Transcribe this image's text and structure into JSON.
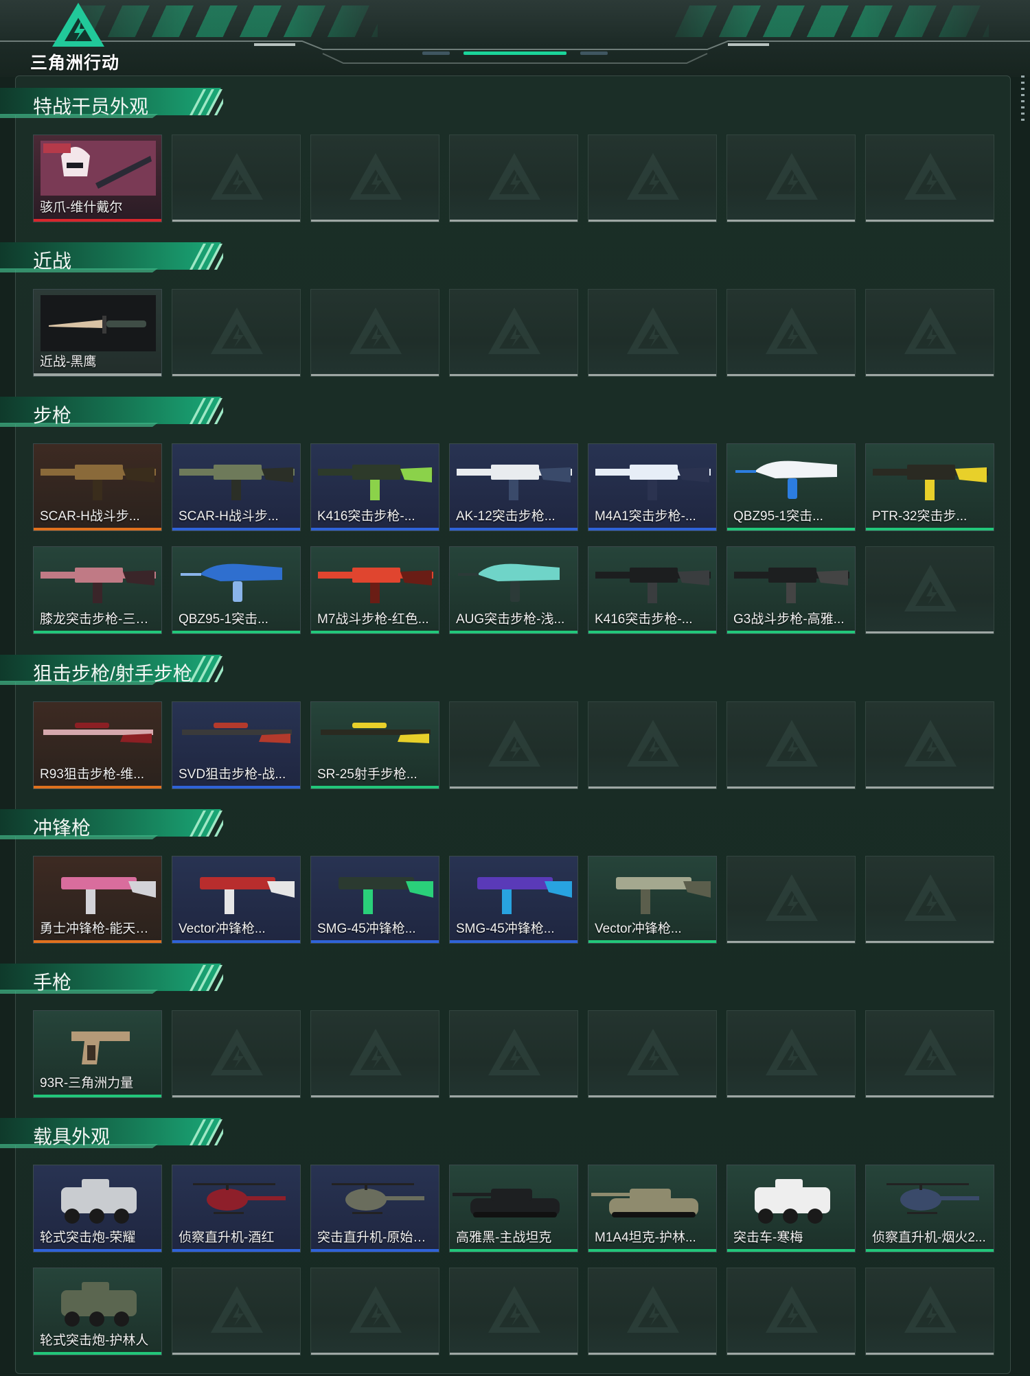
{
  "app": {
    "logo_text": "三角洲行动"
  },
  "colors": {
    "accent": "#19d39a",
    "rarity_red": "#d8262c",
    "rarity_orange": "#e0711e",
    "rarity_blue": "#2f63d8",
    "rarity_green": "#22c77a",
    "rarity_empty": "#9ea7a4"
  },
  "sections": [
    {
      "title": "特战干员外观",
      "rows": [
        [
          {
            "label": "骇爪-维什戴尔",
            "rarity": "red",
            "icon": "operator-portrait"
          },
          null,
          null,
          null,
          null,
          null,
          null
        ]
      ]
    },
    {
      "title": "近战",
      "rows": [
        [
          {
            "label": "近战-黑鹰",
            "rarity": "gray",
            "icon": "knife"
          },
          null,
          null,
          null,
          null,
          null,
          null
        ]
      ]
    },
    {
      "title": "步枪",
      "rows": [
        [
          {
            "label": "SCAR-H战斗步...",
            "rarity": "orange",
            "icon": "rifle-gold"
          },
          {
            "label": "SCAR-H战斗步...",
            "rarity": "blue",
            "icon": "rifle-green"
          },
          {
            "label": "K416突击步枪-...",
            "rarity": "blue",
            "icon": "rifle-dark"
          },
          {
            "label": "AK-12突击步枪...",
            "rarity": "blue",
            "icon": "rifle-white"
          },
          {
            "label": "M4A1突击步枪-...",
            "rarity": "blue",
            "icon": "rifle-bluewhite"
          },
          {
            "label": "QBZ95-1突击...",
            "rarity": "green",
            "icon": "bullpup-white"
          },
          {
            "label": "PTR-32突击步...",
            "rarity": "green",
            "icon": "rifle-yellow"
          }
        ],
        [
          {
            "label": "膝龙突击步枪-三角...",
            "rarity": "green",
            "icon": "rifle-pink"
          },
          {
            "label": "QBZ95-1突击...",
            "rarity": "green",
            "icon": "bullpup-blue"
          },
          {
            "label": "M7战斗步枪-红色...",
            "rarity": "green",
            "icon": "rifle-red"
          },
          {
            "label": "AUG突击步枪-浅...",
            "rarity": "green",
            "icon": "bullpup-teal"
          },
          {
            "label": "K416突击步枪-...",
            "rarity": "green",
            "icon": "rifle-black"
          },
          {
            "label": "G3战斗步枪-高雅...",
            "rarity": "green",
            "icon": "rifle-black2"
          },
          null
        ]
      ]
    },
    {
      "title": "狙击步枪/射手步枪",
      "rows": [
        [
          {
            "label": "R93狙击步枪-维...",
            "rarity": "orange",
            "icon": "sniper-pink"
          },
          {
            "label": "SVD狙击步枪-战...",
            "rarity": "blue",
            "icon": "sniper-red"
          },
          {
            "label": "SR-25射手步枪...",
            "rarity": "green",
            "icon": "sniper-yellow"
          },
          null,
          null,
          null,
          null
        ]
      ]
    },
    {
      "title": "冲锋枪",
      "rows": [
        [
          {
            "label": "勇士冲锋枪-能天使...",
            "rarity": "orange",
            "icon": "smg-pink"
          },
          {
            "label": "Vector冲锋枪...",
            "rarity": "blue",
            "icon": "smg-redcamo"
          },
          {
            "label": "SMG-45冲锋枪...",
            "rarity": "blue",
            "icon": "smg-green"
          },
          {
            "label": "SMG-45冲锋枪...",
            "rarity": "blue",
            "icon": "smg-purple"
          },
          {
            "label": "Vector冲锋枪...",
            "rarity": "green",
            "icon": "smg-camo"
          },
          null,
          null
        ]
      ]
    },
    {
      "title": "手枪",
      "rows": [
        [
          {
            "label": "93R-三角洲力量",
            "rarity": "green",
            "icon": "pistol"
          },
          null,
          null,
          null,
          null,
          null,
          null
        ]
      ]
    },
    {
      "title": "载具外观",
      "rows": [
        [
          {
            "label": "轮式突击炮-荣耀",
            "rarity": "blue",
            "icon": "vehicle-apc"
          },
          {
            "label": "侦察直升机-酒红",
            "rarity": "blue",
            "icon": "heli-red"
          },
          {
            "label": "突击直升机-原始伪...",
            "rarity": "blue",
            "icon": "heli-attack"
          },
          {
            "label": "高雅黑-主战坦克",
            "rarity": "green",
            "icon": "tank-black"
          },
          {
            "label": "M1A4坦克-护林...",
            "rarity": "green",
            "icon": "tank-camo"
          },
          {
            "label": "突击车-寒梅",
            "rarity": "green",
            "icon": "vehicle-white"
          },
          {
            "label": "侦察直升机-烟火2...",
            "rarity": "green",
            "icon": "heli-blue"
          }
        ],
        [
          {
            "label": "轮式突击炮-护林人",
            "rarity": "green",
            "icon": "vehicle-camo"
          },
          null,
          null,
          null,
          null,
          null,
          null
        ]
      ]
    }
  ]
}
